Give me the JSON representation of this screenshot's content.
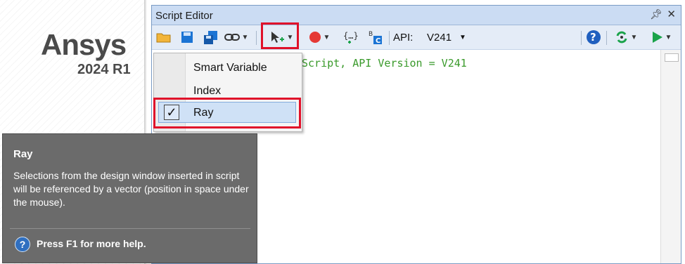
{
  "brand": {
    "name": "Ansys",
    "version": "2024 R1"
  },
  "window": {
    "title": "Script Editor"
  },
  "toolbar": {
    "api_label": "API:",
    "api_value": "V241",
    "icons": [
      "open-folder-icon",
      "save-icon",
      "save-as-icon",
      "link-icon",
      "select-cursor-icon",
      "record-icon",
      "variables-icon",
      "block-icon",
      "help-icon",
      "loop-icon",
      "run-icon"
    ],
    "colors": {
      "record": "#e53935",
      "run": "#1aa34a",
      "help": "#1f5fbf"
    }
  },
  "editor": {
    "code_line": "Script, API Version = V241"
  },
  "menu": {
    "items": [
      {
        "label": "Smart Variable",
        "checked": false
      },
      {
        "label": "Index",
        "checked": false
      },
      {
        "label": "Ray",
        "checked": true
      }
    ],
    "check_mark": "✓"
  },
  "tooltip": {
    "title": "Ray",
    "body": "Selections from the design window inserted in script will be referenced by a vector (position in space under the mouse).",
    "help": "Press F1 for more help."
  },
  "annotation_color": "#e0112a"
}
